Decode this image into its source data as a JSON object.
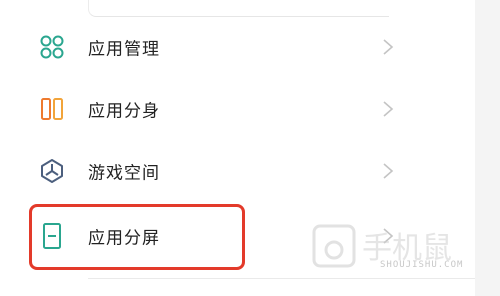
{
  "menu": {
    "items": [
      {
        "label": "应用管理",
        "icon": "app-management-icon"
      },
      {
        "label": "应用分身",
        "icon": "app-clone-icon"
      },
      {
        "label": "游戏空间",
        "icon": "game-space-icon"
      },
      {
        "label": "应用分屏",
        "icon": "split-screen-icon"
      }
    ]
  },
  "watermark": {
    "text": "手机鼠",
    "sub": "SHOUJISHU.COM"
  },
  "colors": {
    "highlight": "#e33a2a",
    "teal": "#2aa68f",
    "orange": "#ee7a2e",
    "slate": "#4c5f7e"
  }
}
